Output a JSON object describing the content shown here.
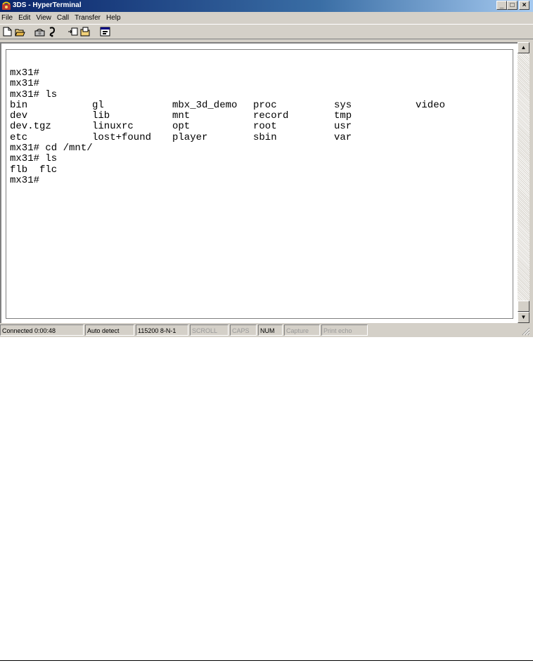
{
  "window": {
    "title": "3DS - HyperTerminal",
    "app_icon": "hyperterminal-phone-icon",
    "buttons": {
      "minimize": "_",
      "maximize": "□",
      "close": "×"
    }
  },
  "menu": [
    "File",
    "Edit",
    "View",
    "Call",
    "Transfer",
    "Help"
  ],
  "toolbar": {
    "icons": [
      "new-connection-icon",
      "open-icon",
      "connect-icon",
      "disconnect-icon",
      "send-icon",
      "receive-icon",
      "properties-icon"
    ]
  },
  "terminal": {
    "lines": [
      [
        "mx31#"
      ],
      [
        "mx31#"
      ],
      [
        "mx31# ls"
      ],
      [
        "bin",
        "gl",
        "mbx_3d_demo",
        "proc",
        "sys",
        "video"
      ],
      [
        "dev",
        "lib",
        "mnt",
        "record",
        "tmp"
      ],
      [
        "dev.tgz",
        "linuxrc",
        "opt",
        "root",
        "usr"
      ],
      [
        "etc",
        "lost+found",
        "player",
        "sbin",
        "var"
      ],
      [
        "mx31# cd /mnt/"
      ],
      [
        "mx31# ls"
      ],
      [
        "flb  flc"
      ],
      [
        "mx31#"
      ]
    ]
  },
  "scrollbar": {
    "up": "▲",
    "down": "▼"
  },
  "status": {
    "connected": "Connected 0:00:48",
    "detect": "Auto detect",
    "settings": "115200 8-N-1",
    "scroll": "SCROLL",
    "caps": "CAPS",
    "num": "NUM",
    "capture": "Capture",
    "print_echo": "Print echo"
  }
}
